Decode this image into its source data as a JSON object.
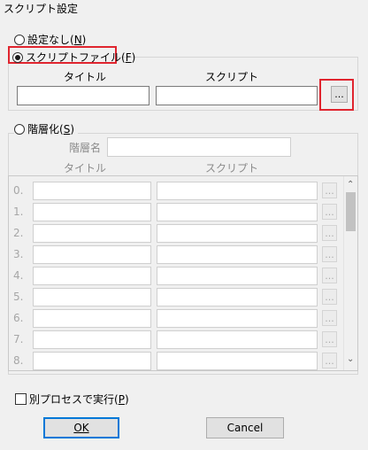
{
  "dialog": {
    "title": "スクリプト設定"
  },
  "options": {
    "none": {
      "label": "設定なし(",
      "key": "N",
      "suffix": ")"
    },
    "script_file": {
      "label": "スクリプトファイル(",
      "key": "F",
      "suffix": ")"
    },
    "hierarchical": {
      "label": "階層化(",
      "key": "S",
      "suffix": ")"
    }
  },
  "script_file_group": {
    "title_header": "タイトル",
    "script_header": "スクリプト",
    "title_value": "",
    "script_value": "",
    "browse_label": "..."
  },
  "hier_group": {
    "name_label": "階層名",
    "name_value": "",
    "title_header": "タイトル",
    "script_header": "スクリプト",
    "rows": [
      "0.",
      "1.",
      "2.",
      "3.",
      "4.",
      "5.",
      "6.",
      "7.",
      "8."
    ],
    "browse_label": "..."
  },
  "separate_process": {
    "label": "別プロセスで実行(",
    "key": "P",
    "suffix": ")"
  },
  "buttons": {
    "ok": {
      "label": "OK",
      "key": "O"
    },
    "cancel": {
      "label": "Cancel"
    }
  }
}
